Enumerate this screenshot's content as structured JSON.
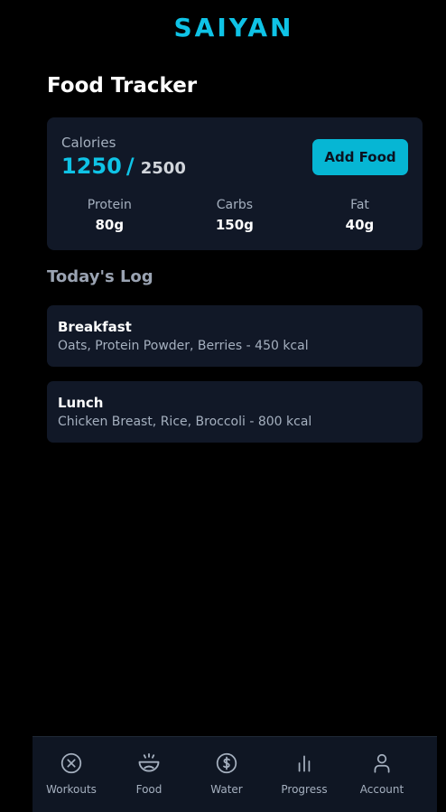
{
  "brand": "SAIYAN",
  "page_title": "Food Tracker",
  "summary": {
    "calories_label": "Calories",
    "calories_current": "1250",
    "calories_separator": "/",
    "calories_goal": "2500",
    "add_food_label": "Add Food",
    "macros": [
      {
        "label": "Protein",
        "value": "80g"
      },
      {
        "label": "Carbs",
        "value": "150g"
      },
      {
        "label": "Fat",
        "value": "40g"
      }
    ]
  },
  "log": {
    "title": "Today's Log",
    "entries": [
      {
        "meal": "Breakfast",
        "detail": "Oats, Protein Powder, Berries - 450 kcal"
      },
      {
        "meal": "Lunch",
        "detail": "Chicken Breast, Rice, Broccoli - 800 kcal"
      }
    ]
  },
  "nav": {
    "items": [
      {
        "label": "Workouts",
        "icon": "x-circle-icon"
      },
      {
        "label": "Food",
        "icon": "bowl-icon"
      },
      {
        "label": "Water",
        "icon": "dollar-circle-icon"
      },
      {
        "label": "Progress",
        "icon": "bar-chart-icon"
      },
      {
        "label": "Account",
        "icon": "user-icon"
      }
    ]
  },
  "colors": {
    "accent": "#0fc3e6",
    "button": "#06b6d4",
    "card": "#111827",
    "background": "#000000"
  }
}
